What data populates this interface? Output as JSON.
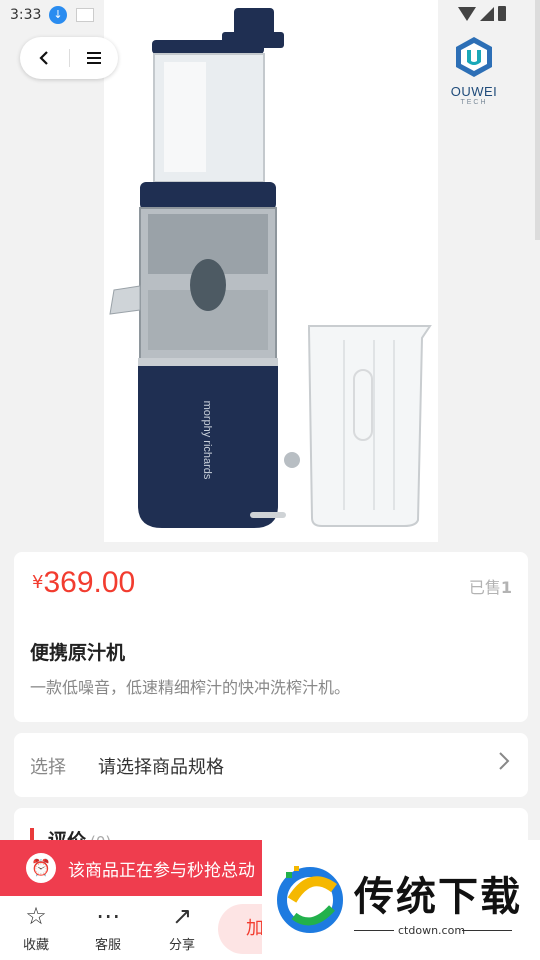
{
  "status_bar": {
    "time": "3:33"
  },
  "brand": {
    "name": "OUWEI",
    "sub": "TECH"
  },
  "product": {
    "currency": "¥",
    "price": "369.00",
    "sold_label": "已售",
    "sold_count": "1",
    "title": "便携原汁机",
    "description": "一款低噪音，低速精细榨汁的快冲洗榨汁机。"
  },
  "spec": {
    "label": "选择",
    "value": "请选择商品规格"
  },
  "review": {
    "title": "评价",
    "count": "(0)"
  },
  "flash": {
    "text": "该商品正在参与秒抢总动"
  },
  "bottom_bar": {
    "favorite": "收藏",
    "service": "客服",
    "share": "分享",
    "add_cart": "加"
  },
  "watermark": {
    "text": "传统下载",
    "url": "ctdown.com"
  },
  "colors": {
    "price": "#f23c2f",
    "banner": "#ef3d4e",
    "juicer_body": "#1f2f52"
  }
}
